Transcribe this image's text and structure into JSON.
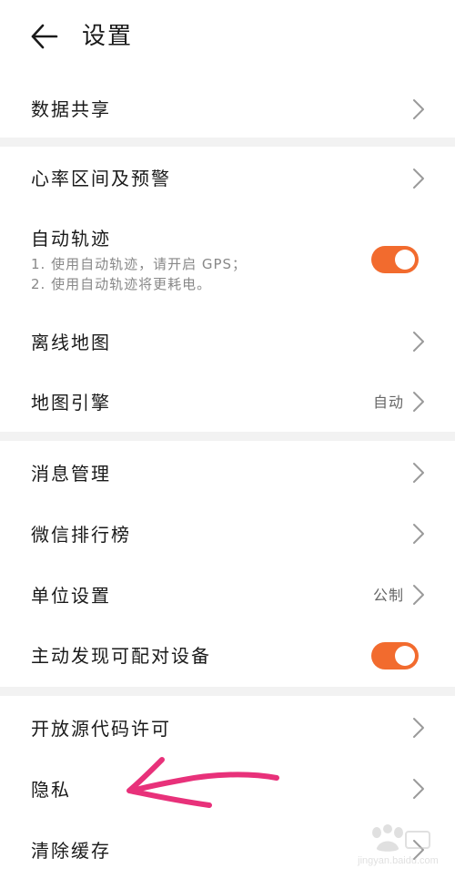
{
  "header": {
    "title": "设置"
  },
  "sections": {
    "data_share": {
      "label": "数据共享"
    },
    "heart_rate": {
      "label": "心率区间及预警"
    },
    "auto_track": {
      "label": "自动轨迹",
      "desc_line1": "1. 使用自动轨迹，请开启 GPS；",
      "desc_line2": "2. 使用自动轨迹将更耗电。",
      "enabled": true
    },
    "offline_map": {
      "label": "离线地图"
    },
    "map_engine": {
      "label": "地图引擎",
      "value": "自动"
    },
    "message_mgmt": {
      "label": "消息管理"
    },
    "wechat_rank": {
      "label": "微信排行榜"
    },
    "unit_settings": {
      "label": "单位设置",
      "value": "公制"
    },
    "discover_devices": {
      "label": "主动发现可配对设备",
      "enabled": true
    },
    "open_source": {
      "label": "开放源代码许可"
    },
    "privacy": {
      "label": "隐私"
    },
    "clear_cache": {
      "label": "清除缓存"
    }
  },
  "colors": {
    "toggle_on": "#f26b2e",
    "annotation_arrow": "#e8317a",
    "section_gap": "#f2f2f2"
  },
  "icons": {
    "back": "arrow-left-icon",
    "chevron": "chevron-right-icon"
  },
  "watermark": {
    "text": "jingyan.baidu.com"
  }
}
